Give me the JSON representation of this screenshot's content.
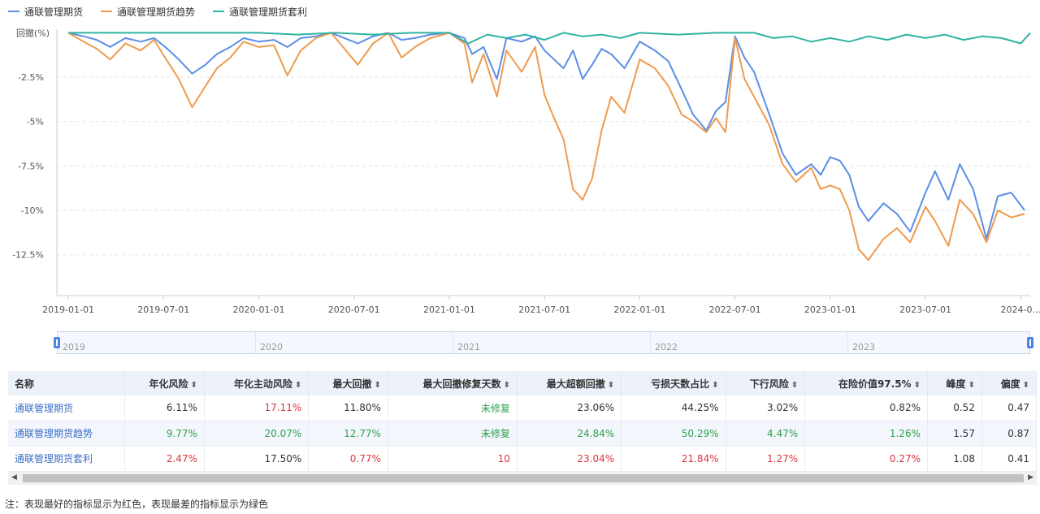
{
  "legend": [
    {
      "name": "通联管理期货",
      "color": "#5b8ee6"
    },
    {
      "name": "通联管理期货趋势",
      "color": "#ef9a4e"
    },
    {
      "name": "通联管理期货套利",
      "color": "#2fb3a2"
    }
  ],
  "chart_data": {
    "type": "line",
    "ylabel": "回撤(%)",
    "y_ticks": [
      "-2.5%",
      "-5%",
      "-7.5%",
      "-10%",
      "-12.5%"
    ],
    "y_tick_values": [
      -2.5,
      -5,
      -7.5,
      -10,
      -12.5
    ],
    "ylim": [
      -14.8,
      0.2
    ],
    "x_ticks": [
      "2019-01-01",
      "2019-07-01",
      "2020-01-01",
      "2020-07-01",
      "2021-01-01",
      "2021-07-01",
      "2022-01-01",
      "2022-07-01",
      "2023-01-01",
      "2023-07-01",
      "2024-0..."
    ],
    "x_tick_values": [
      2019.0,
      2019.5,
      2020.0,
      2020.5,
      2021.0,
      2021.5,
      2022.0,
      2022.5,
      2023.0,
      2023.5,
      2024.0
    ],
    "xlim": [
      2018.94,
      2024.05
    ],
    "grid": true,
    "legend_position": "top-left",
    "series": [
      {
        "name": "通联管理期货",
        "color": "#5b8ee6",
        "x": [
          2019.0,
          2019.08,
          2019.15,
          2019.22,
          2019.3,
          2019.38,
          2019.45,
          2019.52,
          2019.58,
          2019.65,
          2019.72,
          2019.78,
          2019.85,
          2019.92,
          2020.0,
          2020.08,
          2020.15,
          2020.22,
          2020.3,
          2020.38,
          2020.45,
          2020.52,
          2020.6,
          2020.68,
          2020.75,
          2020.82,
          2020.9,
          2021.0,
          2021.08,
          2021.12,
          2021.18,
          2021.25,
          2021.3,
          2021.38,
          2021.45,
          2021.5,
          2021.55,
          2021.6,
          2021.65,
          2021.7,
          2021.75,
          2021.8,
          2021.85,
          2021.92,
          2022.0,
          2022.08,
          2022.15,
          2022.22,
          2022.28,
          2022.35,
          2022.4,
          2022.45,
          2022.5,
          2022.55,
          2022.6,
          2022.68,
          2022.75,
          2022.82,
          2022.9,
          2022.95,
          2023.0,
          2023.05,
          2023.1,
          2023.15,
          2023.2,
          2023.28,
          2023.35,
          2023.42,
          2023.5,
          2023.55,
          2023.62,
          2023.68,
          2023.75,
          2023.82,
          2023.88,
          2023.95,
          2024.02
        ],
        "values": [
          0,
          -0.2,
          -0.4,
          -0.8,
          -0.3,
          -0.5,
          -0.3,
          -0.9,
          -1.5,
          -2.3,
          -1.8,
          -1.2,
          -0.8,
          -0.3,
          -0.5,
          -0.4,
          -0.8,
          -0.3,
          -0.2,
          0,
          -0.3,
          -0.6,
          -0.2,
          0,
          -0.4,
          -0.3,
          -0.1,
          0,
          -0.3,
          -1.2,
          -0.8,
          -2.6,
          -0.3,
          -0.5,
          -0.2,
          -1.0,
          -1.5,
          -2.0,
          -1.0,
          -2.6,
          -1.8,
          -0.9,
          -1.2,
          -2.0,
          -0.5,
          -1.0,
          -1.6,
          -3.2,
          -4.6,
          -5.5,
          -4.4,
          -3.9,
          -0.2,
          -1.4,
          -2.2,
          -4.6,
          -6.8,
          -8.0,
          -7.4,
          -8.0,
          -7.0,
          -7.2,
          -8.0,
          -9.8,
          -10.6,
          -9.6,
          -10.2,
          -11.2,
          -9.0,
          -7.8,
          -9.4,
          -7.4,
          -8.8,
          -11.6,
          -9.2,
          -9.0,
          -10.0
        ]
      },
      {
        "name": "通联管理期货趋势",
        "color": "#ef9a4e",
        "x": [
          2019.0,
          2019.08,
          2019.15,
          2019.22,
          2019.3,
          2019.38,
          2019.45,
          2019.52,
          2019.58,
          2019.65,
          2019.72,
          2019.78,
          2019.85,
          2019.92,
          2020.0,
          2020.08,
          2020.15,
          2020.22,
          2020.3,
          2020.38,
          2020.45,
          2020.52,
          2020.6,
          2020.68,
          2020.75,
          2020.82,
          2020.9,
          2021.0,
          2021.08,
          2021.12,
          2021.18,
          2021.25,
          2021.3,
          2021.38,
          2021.45,
          2021.5,
          2021.55,
          2021.6,
          2021.65,
          2021.7,
          2021.75,
          2021.8,
          2021.85,
          2021.92,
          2022.0,
          2022.08,
          2022.15,
          2022.22,
          2022.28,
          2022.35,
          2022.4,
          2022.45,
          2022.5,
          2022.55,
          2022.6,
          2022.68,
          2022.75,
          2022.82,
          2022.9,
          2022.95,
          2023.0,
          2023.05,
          2023.1,
          2023.15,
          2023.2,
          2023.28,
          2023.35,
          2023.42,
          2023.5,
          2023.55,
          2023.62,
          2023.68,
          2023.75,
          2023.82,
          2023.88,
          2023.95,
          2024.02
        ],
        "values": [
          0,
          -0.5,
          -0.9,
          -1.5,
          -0.6,
          -1.0,
          -0.4,
          -1.6,
          -2.6,
          -4.2,
          -3.0,
          -2.0,
          -1.4,
          -0.5,
          -0.8,
          -0.7,
          -2.4,
          -1.0,
          -0.3,
          0,
          -0.9,
          -1.8,
          -0.6,
          0,
          -1.4,
          -0.8,
          -0.3,
          0,
          -0.6,
          -2.8,
          -1.2,
          -3.6,
          -1.0,
          -2.2,
          -0.8,
          -3.5,
          -4.8,
          -6.0,
          -8.8,
          -9.4,
          -8.2,
          -5.5,
          -3.6,
          -4.5,
          -1.5,
          -2.0,
          -3.0,
          -4.6,
          -5.0,
          -5.6,
          -4.8,
          -5.6,
          -0.3,
          -2.6,
          -3.6,
          -5.2,
          -7.4,
          -8.4,
          -7.6,
          -8.8,
          -8.6,
          -8.8,
          -10.0,
          -12.2,
          -12.8,
          -11.6,
          -11.0,
          -11.8,
          -9.8,
          -10.6,
          -12.0,
          -9.4,
          -10.2,
          -11.8,
          -10.0,
          -10.4,
          -10.2
        ]
      },
      {
        "name": "通联管理期货套利",
        "color": "#2fb3a2",
        "x": [
          2019.0,
          2019.2,
          2019.4,
          2019.6,
          2019.8,
          2020.0,
          2020.2,
          2020.4,
          2020.6,
          2020.8,
          2021.0,
          2021.1,
          2021.2,
          2021.3,
          2021.4,
          2021.5,
          2021.6,
          2021.7,
          2021.8,
          2021.9,
          2022.0,
          2022.2,
          2022.4,
          2022.6,
          2022.7,
          2022.8,
          2022.9,
          2023.0,
          2023.1,
          2023.2,
          2023.3,
          2023.4,
          2023.5,
          2023.6,
          2023.7,
          2023.8,
          2023.9,
          2024.0,
          2024.05
        ],
        "values": [
          0,
          0,
          0,
          0,
          0,
          0,
          -0.1,
          0,
          -0.1,
          0,
          0,
          -0.6,
          -0.1,
          -0.3,
          -0.1,
          -0.4,
          0,
          -0.2,
          -0.1,
          -0.3,
          0,
          -0.1,
          0,
          0,
          -0.3,
          -0.2,
          -0.5,
          -0.3,
          -0.5,
          -0.2,
          -0.4,
          -0.1,
          -0.3,
          -0.1,
          -0.4,
          -0.2,
          -0.3,
          -0.6,
          0
        ]
      }
    ]
  },
  "slider": {
    "years": [
      "2019",
      "2020",
      "2021",
      "2022",
      "2023"
    ]
  },
  "table": {
    "headers": [
      "名称",
      "年化风险",
      "年化主动风险",
      "最大回撤",
      "最大回撤修复天数",
      "最大超额回撤",
      "亏损天数占比",
      "下行风险",
      "在险价值97.5%",
      "峰度",
      "偏度"
    ],
    "rows": [
      {
        "cells": [
          "通联管理期货",
          "6.11%",
          "17.11%",
          "11.80%",
          "未修复",
          "23.06%",
          "44.25%",
          "3.02%",
          "0.82%",
          "0.52",
          "0.47"
        ],
        "colors": [
          "",
          "",
          "red",
          "",
          "green",
          "",
          "",
          "",
          "",
          "",
          ""
        ]
      },
      {
        "cells": [
          "通联管理期货趋势",
          "9.77%",
          "20.07%",
          "12.77%",
          "未修复",
          "24.84%",
          "50.29%",
          "4.47%",
          "1.26%",
          "1.57",
          "0.87"
        ],
        "colors": [
          "",
          "green",
          "green",
          "green",
          "green",
          "green",
          "green",
          "green",
          "green",
          "",
          ""
        ]
      },
      {
        "cells": [
          "通联管理期货套利",
          "2.47%",
          "17.50%",
          "0.77%",
          "10",
          "23.04%",
          "21.84%",
          "1.27%",
          "0.27%",
          "1.08",
          "0.41"
        ],
        "colors": [
          "",
          "red",
          "",
          "red",
          "red",
          "red",
          "red",
          "red",
          "red",
          "",
          ""
        ]
      }
    ]
  },
  "note": "注：表现最好的指标显示为红色，表现最差的指标显示为绿色"
}
